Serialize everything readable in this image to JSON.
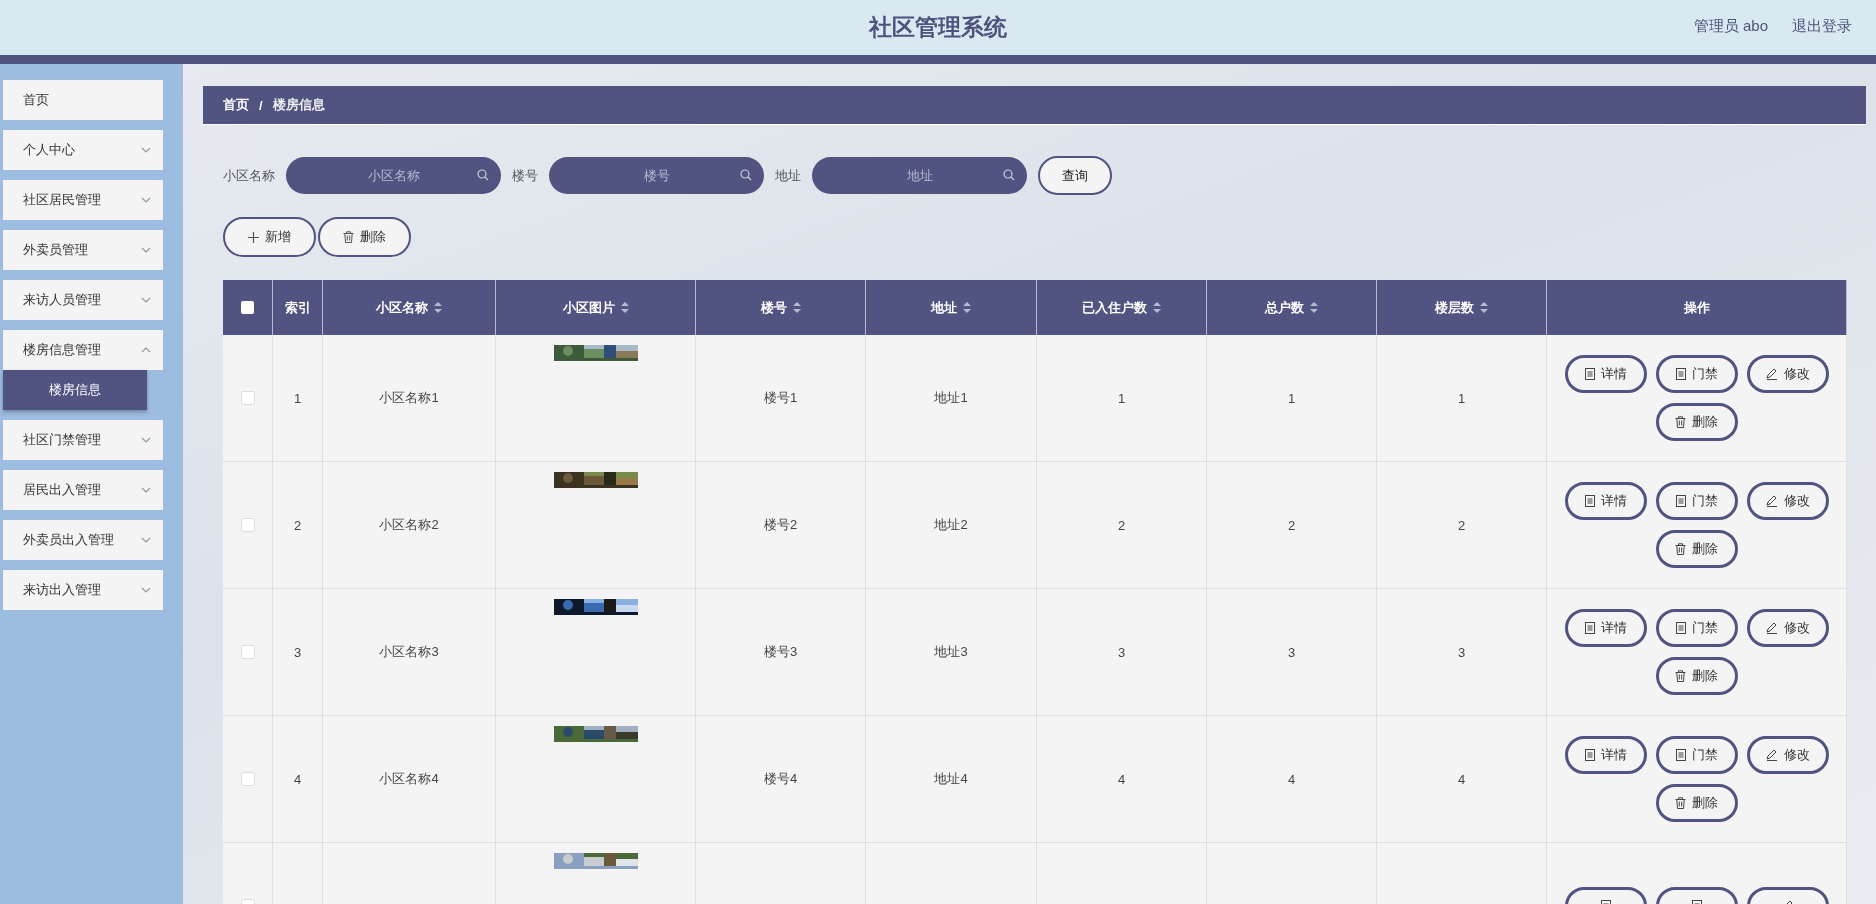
{
  "header": {
    "title": "社区管理系统",
    "user": "管理员 abo",
    "logout": "退出登录"
  },
  "sidebar": {
    "items": [
      {
        "label": "首页",
        "kind": "link"
      },
      {
        "label": "个人中心",
        "kind": "submenu",
        "expanded": false
      },
      {
        "label": "社区居民管理",
        "kind": "submenu",
        "expanded": false
      },
      {
        "label": "外卖员管理",
        "kind": "submenu",
        "expanded": false
      },
      {
        "label": "来访人员管理",
        "kind": "submenu",
        "expanded": false
      },
      {
        "label": "楼房信息管理",
        "kind": "submenu",
        "expanded": true,
        "children": [
          {
            "label": "楼房信息",
            "selected": true
          }
        ]
      },
      {
        "label": "社区门禁管理",
        "kind": "submenu",
        "expanded": false
      },
      {
        "label": "居民出入管理",
        "kind": "submenu",
        "expanded": false
      },
      {
        "label": "外卖员出入管理",
        "kind": "submenu",
        "expanded": false
      },
      {
        "label": "来访出入管理",
        "kind": "submenu",
        "expanded": false
      }
    ]
  },
  "breadcrumb": {
    "items": [
      "首页",
      "楼房信息"
    ],
    "separator": "/"
  },
  "search": {
    "fields": [
      {
        "label": "小区名称",
        "placeholder": "小区名称"
      },
      {
        "label": "楼号",
        "placeholder": "楼号"
      },
      {
        "label": "地址",
        "placeholder": "地址"
      }
    ],
    "button": "查询"
  },
  "toolbar": [
    {
      "label": "新增",
      "kind": "add"
    },
    {
      "label": "删除",
      "kind": "delete"
    }
  ],
  "table": {
    "select_all": false,
    "columns": [
      {
        "label": "索引",
        "kind": "text",
        "sortable": false
      },
      {
        "label": "小区名称",
        "kind": "text",
        "sortable": true
      },
      {
        "label": "小区图片",
        "sortable": true
      },
      {
        "label": "楼号",
        "kind": "text",
        "sortable": true
      },
      {
        "label": "地址",
        "kind": "text",
        "sortable": true
      },
      {
        "label": "已入住户数",
        "kind": "text",
        "sortable": true
      },
      {
        "label": "总户数",
        "kind": "text",
        "sortable": true
      },
      {
        "label": "楼层数",
        "kind": "text",
        "sortable": true
      },
      {
        "label": "操作",
        "kind": "actions",
        "sortable": false
      }
    ],
    "rows": [
      {
        "checked": false,
        "image": {
          "kind": "picture"
        },
        "cells": [
          "1",
          "小区名称1",
          "楼号1",
          "地址1",
          "1",
          "1",
          "1"
        ],
        "actions": [
          {
            "label": "详情",
            "kind": "doc"
          },
          {
            "label": "门禁",
            "kind": "doc"
          },
          {
            "label": "修改",
            "kind": "edit"
          },
          {
            "label": "删除",
            "kind": "delete"
          }
        ]
      },
      {
        "checked": false,
        "image": {
          "kind": "picture"
        },
        "cells": [
          "2",
          "小区名称2",
          "楼号2",
          "地址2",
          "2",
          "2",
          "2"
        ],
        "actions": [
          {
            "label": "详情",
            "kind": "doc"
          },
          {
            "label": "门禁",
            "kind": "doc"
          },
          {
            "label": "修改",
            "kind": "edit"
          },
          {
            "label": "删除",
            "kind": "delete"
          }
        ]
      },
      {
        "checked": false,
        "image": {
          "kind": "picture"
        },
        "cells": [
          "3",
          "小区名称3",
          "楼号3",
          "地址3",
          "3",
          "3",
          "3"
        ],
        "actions": [
          {
            "label": "详情",
            "kind": "doc"
          },
          {
            "label": "门禁",
            "kind": "doc"
          },
          {
            "label": "修改",
            "kind": "edit"
          },
          {
            "label": "删除",
            "kind": "delete"
          }
        ]
      },
      {
        "checked": false,
        "image": {
          "kind": "picture"
        },
        "cells": [
          "4",
          "小区名称4",
          "楼号4",
          "地址4",
          "4",
          "4",
          "4"
        ],
        "actions": [
          {
            "label": "详情",
            "kind": "doc"
          },
          {
            "label": "门禁",
            "kind": "doc"
          },
          {
            "label": "修改",
            "kind": "edit"
          },
          {
            "label": "删除",
            "kind": "delete"
          }
        ]
      },
      {
        "checked": false,
        "image": {
          "kind": "picture"
        },
        "actions": [
          {
            "kind": "doc"
          },
          {
            "kind": "doc"
          },
          {
            "kind": "edit"
          }
        ]
      }
    ]
  }
}
